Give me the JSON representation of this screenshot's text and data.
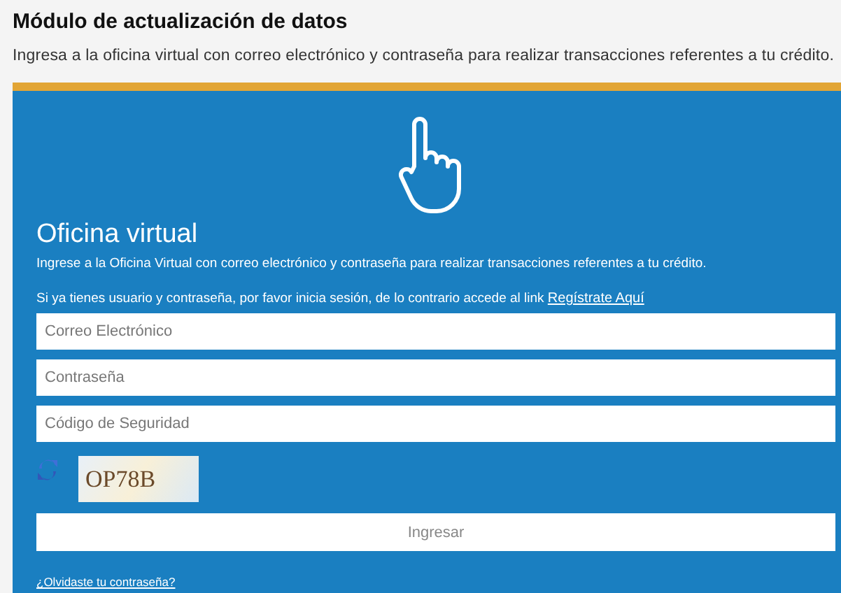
{
  "header": {
    "title": "Módulo de actualización de datos",
    "subtitle": "Ingresa a la oficina virtual con correo electrónico y contraseña para realizar transacciones referentes a tu crédito."
  },
  "panel": {
    "title": "Oficina virtual",
    "intro": "Ingrese a la Oficina Virtual con correo electrónico y contraseña para realizar transacciones referentes a tu crédito.",
    "login_note": "Si ya tienes usuario y contraseña, por favor inicia sesión, de lo contrario accede al link",
    "register_link": "Regístrate Aquí",
    "fields": [
      {
        "placeholder": "Correo Electrónico"
      },
      {
        "placeholder": "Contraseña"
      },
      {
        "placeholder": "Código de Seguridad"
      }
    ],
    "captcha": "OP78B",
    "submit": "Ingresar",
    "forgot_link": "¿Olvidaste tu contraseña?"
  }
}
